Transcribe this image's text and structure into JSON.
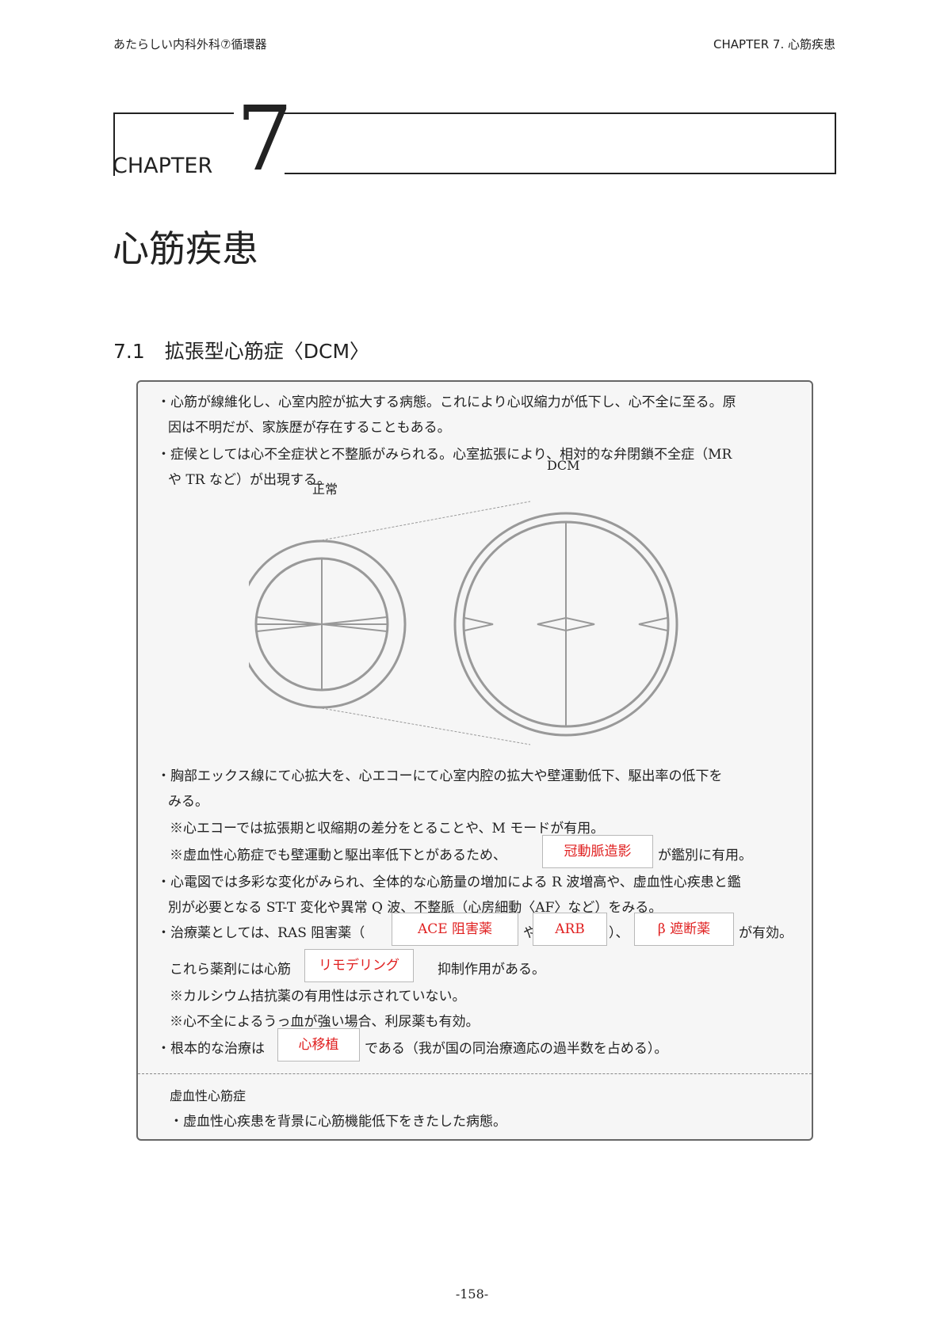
{
  "header": {
    "book_title": "あたらしい内科外科⑦循環器",
    "chapter_ref": "CHAPTER 7. 心筋疾患"
  },
  "chapter": {
    "word": "CHAPTER",
    "number": "7",
    "title": "心筋疾患"
  },
  "section": {
    "title": "7.1　拡張型心筋症〈DCM〉"
  },
  "box": {
    "p1_line1": "・心筋が線維化し、心室内腔が拡大する病態。これにより心収縮力が低下し、心不全に至る。原",
    "p1_line2": "因は不明だが、家族歴が存在することもある。",
    "p2_line1": "・症候としては心不全症状と不整脈がみられる。心室拡張により、相対的な弁閉鎖不全症（MR",
    "p2_line2": "や TR など）が出現する。",
    "diagram": {
      "label_normal": "正常",
      "label_dcm": "DCM"
    },
    "p3_line1": "・胸部エックス線にて心拡大を、心エコーにて心室内腔の拡大や壁運動低下、駆出率の低下を",
    "p3_line2": "みる。",
    "note1": "※心エコーでは拡張期と収縮期の差分をとることや、M モードが有用。",
    "note2_before": "※虚血性心筋症でも壁運動と駆出率低下とがあるため、",
    "note2_answer": "冠動脈造影",
    "note2_after": "が鑑別に有用。",
    "p4_line1": "・心電図では多彩な変化がみられ、全体的な心筋量の増加による R 波増高や、虚血性心疾患と鑑",
    "p4_line2": "別が必要となる ST-T 変化や異常 Q 波、不整脈（心房細動〈AF〉など）をみる。",
    "treat_before": "・治療薬としては、RAS 阻害薬（",
    "treat_answer1": "ACE 阻害薬",
    "treat_mid1": "や",
    "treat_answer2": "ARB",
    "treat_mid2": "）、",
    "treat_answer3": "β 遮断薬",
    "treat_after": "が有効。",
    "remod_before": "これら薬剤には心筋",
    "remod_answer": "リモデリング",
    "remod_after": "抑制作用がある。",
    "note3": "※カルシウム拮抗薬の有用性は示されていない。",
    "note4": "※心不全によるうっ血が強い場合、利尿薬も有効。",
    "root_before": "・根本的な治療は",
    "root_answer": "心移植",
    "root_after": "である（我が国の同治療適応の過半数を占める）。",
    "sub_title": "虚血性心筋症",
    "sub_text": "・虚血性心疾患を背景に心筋機能低下をきたした病態。"
  },
  "footer": {
    "page_number": "-158-"
  }
}
